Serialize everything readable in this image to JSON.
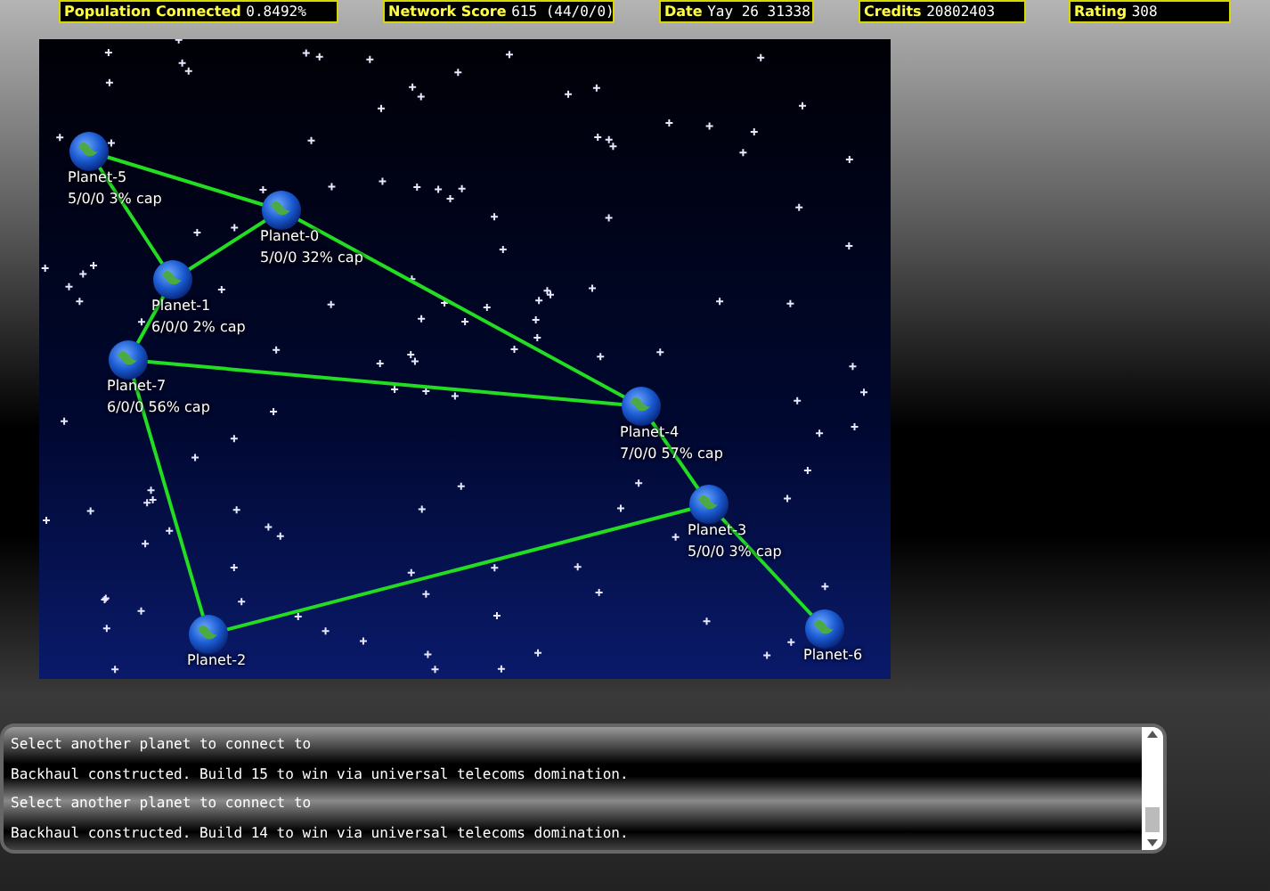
{
  "stats": [
    {
      "label": "Population Connected",
      "value": "0.8492%"
    },
    {
      "label": "Network Score",
      "value": "615 (44/0/0)"
    },
    {
      "label": "Date",
      "value": "Yay 26 31338"
    },
    {
      "label": "Credits",
      "value": "20802403"
    },
    {
      "label": "Rating",
      "value": "308"
    }
  ],
  "planets": [
    {
      "name": "Planet-5",
      "info": "5/0/0  3% cap"
    },
    {
      "name": "Planet-0",
      "info": "5/0/0  32% cap"
    },
    {
      "name": "Planet-1",
      "info": "6/0/0  2% cap"
    },
    {
      "name": "Planet-7",
      "info": "6/0/0  56% cap"
    },
    {
      "name": "Planet-4",
      "info": "7/0/0  57% cap"
    },
    {
      "name": "Planet-3",
      "info": "5/0/0  3% cap"
    },
    {
      "name": "Planet-2"
    },
    {
      "name": "Planet-6"
    }
  ],
  "log": [
    "Select another planet to connect to",
    "Backhaul constructed. Build 15 to win via universal telecoms domination.",
    "Select another planet to connect to",
    "Backhaul constructed. Build 14 to win via universal telecoms domination."
  ]
}
